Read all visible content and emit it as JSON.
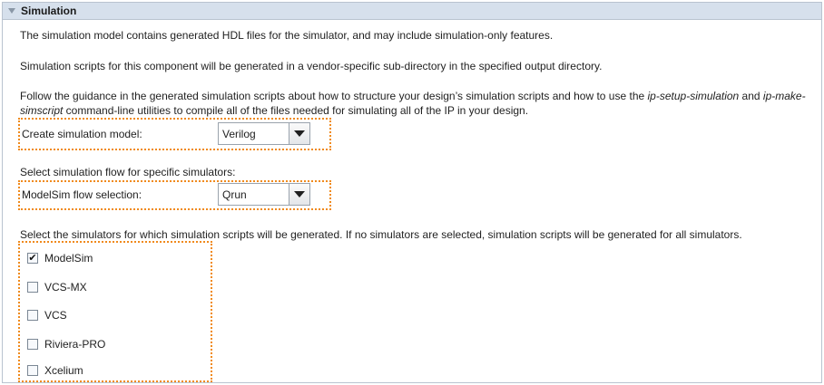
{
  "section": {
    "title": "Simulation"
  },
  "text": {
    "line1": "The simulation model contains generated HDL files for the simulator, and may include simulation-only features.",
    "line2": "Simulation scripts for this component will be generated in a vendor-specific sub-directory in the specified output directory.",
    "line3_a": "Follow the guidance in the generated simulation scripts about how to structure your design’s simulation scripts and how to use the ",
    "line3_em1": "ip-setup-simulation",
    "line3_b": " and ",
    "line3_em2": "ip-make-simscript",
    "line3_c": " command-line utilities to compile all of the files needed for simulating all of the IP in your design.",
    "flow_heading": "Select simulation flow for specific simulators:",
    "simulators_heading": "Select the simulators for which simulation scripts will be generated. If no simulators are selected, simulation scripts will be generated for all simulators."
  },
  "fields": {
    "model": {
      "label": "Create simulation model:",
      "value": "Verilog"
    },
    "flow": {
      "label": "ModelSim flow selection:",
      "value": "Qrun"
    }
  },
  "simulators": [
    {
      "label": "ModelSim",
      "checked": true
    },
    {
      "label": "VCS-MX",
      "checked": false
    },
    {
      "label": "VCS",
      "checked": false
    },
    {
      "label": "Riviera-PRO",
      "checked": false
    },
    {
      "label": "Xcelium",
      "checked": false
    }
  ],
  "colors": {
    "highlight_border": "#f08a1c",
    "header_bg": "#d6e0ec"
  },
  "icons": {
    "collapse": "triangle-down-icon",
    "dropdown": "chevron-down-icon",
    "check": "checkmark-icon"
  }
}
